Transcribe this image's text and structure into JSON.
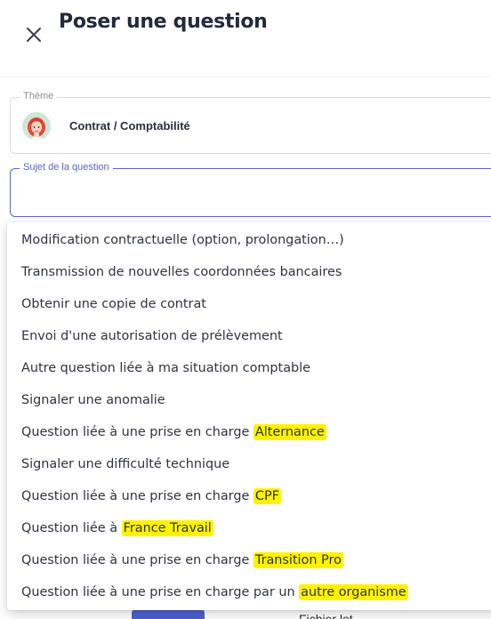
{
  "header": {
    "title": "Poser une question",
    "close_icon": "close-icon"
  },
  "theme": {
    "label": "Thème",
    "value": "Contrat / Comptabilité",
    "avatar_icon": "avatar-woman-red-hair"
  },
  "subject": {
    "label": "Sujet de la question",
    "value": ""
  },
  "highlight_color": "#fff200",
  "accent_color": "#5b63d3",
  "options": [
    {
      "text": "Modification contractuelle (option, prolongation…)",
      "highlight": ""
    },
    {
      "text": "Transmission de nouvelles coordonnées bancaires",
      "highlight": ""
    },
    {
      "text": "Obtenir une copie de contrat",
      "highlight": ""
    },
    {
      "text": "Envoi d'une autorisation de prélèvement",
      "highlight": ""
    },
    {
      "text": "Autre question liée à ma situation comptable",
      "highlight": ""
    },
    {
      "text": "Signaler une anomalie",
      "highlight": ""
    },
    {
      "text": "Question liée à une prise en charge ",
      "highlight": "Alternance"
    },
    {
      "text": "Signaler une difficulté technique",
      "highlight": ""
    },
    {
      "text": "Question liée à une prise en charge ",
      "highlight": "CPF"
    },
    {
      "text": "Question liée à ",
      "highlight": "France Travail"
    },
    {
      "text": "Question liée à une prise en charge ",
      "highlight": "Transition Pro"
    },
    {
      "text": "Question liée à une prise en charge par un ",
      "highlight": "autre organisme"
    }
  ],
  "background": {
    "partial_text": "Fichier lot..."
  }
}
